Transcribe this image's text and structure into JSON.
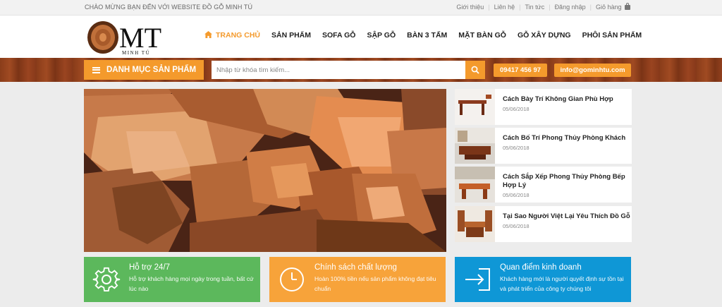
{
  "topbar": {
    "welcome": "CHÀO MỪNG BẠN ĐẾN VỚI WEBSITE ĐỒ GỖ MINH TÚ",
    "links": [
      "Giới thiệu",
      "Liên hệ",
      "Tin tức",
      "Đăng nhập",
      "Giỏ hàng"
    ]
  },
  "logo": {
    "monogram": "MT",
    "brand": "MINH TÚ"
  },
  "nav": {
    "items": [
      "TRANG CHỦ",
      "SẢN PHẨM",
      "SOFA GỖ",
      "SẬP GỖ",
      "BÀN 3 TẤM",
      "MẶT BÀN GỖ",
      "GỖ XÂY DỰNG",
      "PHÔI SẢN PHẨM"
    ],
    "active_index": 0
  },
  "searchbar": {
    "category_label": "DANH MỤC SẢN PHẨM",
    "placeholder": "Nhập từ khóa tìm kiếm...",
    "phone": "09417 456 97",
    "email": "info@gominhtu.com"
  },
  "news": [
    {
      "title": "Cách Bày Trí Không Gian Phù Hợp",
      "date": "05/06/2018"
    },
    {
      "title": "Cách Bố Trí Phong Thủy Phòng Khách",
      "date": "05/06/2018"
    },
    {
      "title": "Cách Sắp Xếp Phong Thủy Phòng Bếp Hợp Lý",
      "date": "05/06/2018"
    },
    {
      "title": "Tại Sao Người Việt Lại Yêu Thích Đồ Gỗ",
      "date": "05/06/2018"
    }
  ],
  "features": [
    {
      "title": "Hỗ trợ 24/7",
      "desc": "Hỗ trợ khách hàng mọi ngày trong tuần, bất cứ lúc nào",
      "icon": "gear-icon"
    },
    {
      "title": "Chính sách chất lượng",
      "desc": "Hoàn 100% tiền nếu sản phẩm không đạt tiêu chuẩn",
      "icon": "clock-icon"
    },
    {
      "title": "Quan điểm kinh doanh",
      "desc": "Khách hàng mới là người quyết định sự tồn tại và phát triển của công ty chúng tôi",
      "icon": "login-icon"
    }
  ],
  "colors": {
    "accent": "#f49a2c",
    "green": "#5cb85c",
    "orange": "#f7a33a",
    "blue": "#0f97d6",
    "wood": "#8a3d1a"
  }
}
